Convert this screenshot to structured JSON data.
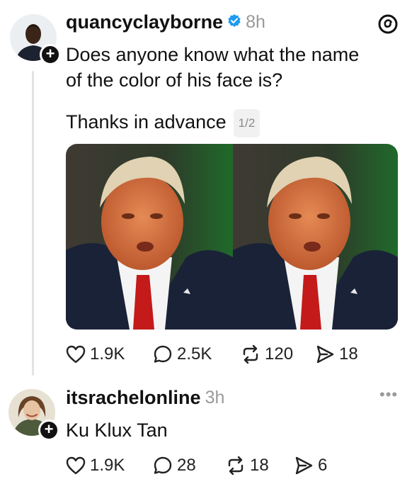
{
  "post": {
    "username": "quancyclayborne",
    "time": "8h",
    "line1": "Does anyone know what the name",
    "line2": "of the color of his face is?",
    "line3": "Thanks in advance",
    "counter": "1/2",
    "stats": {
      "likes": "1.9K",
      "replies": "2.5K",
      "reposts": "120",
      "shares": "18"
    }
  },
  "reply": {
    "username": "itsrachelonline",
    "time": "3h",
    "text": "Ku Klux Tan",
    "stats": {
      "likes": "1.9K",
      "replies": "28",
      "reposts": "18",
      "shares": "6"
    }
  },
  "icons": [
    "threads-logo-icon",
    "verified-badge-icon",
    "follow-plus-icon",
    "heart-icon",
    "reply-icon",
    "repost-icon",
    "share-icon",
    "more-options-icon"
  ],
  "colors": {
    "verified": "#1d9bf0",
    "thread_line": "#e3e3e3",
    "muted": "#9a9a9a"
  }
}
